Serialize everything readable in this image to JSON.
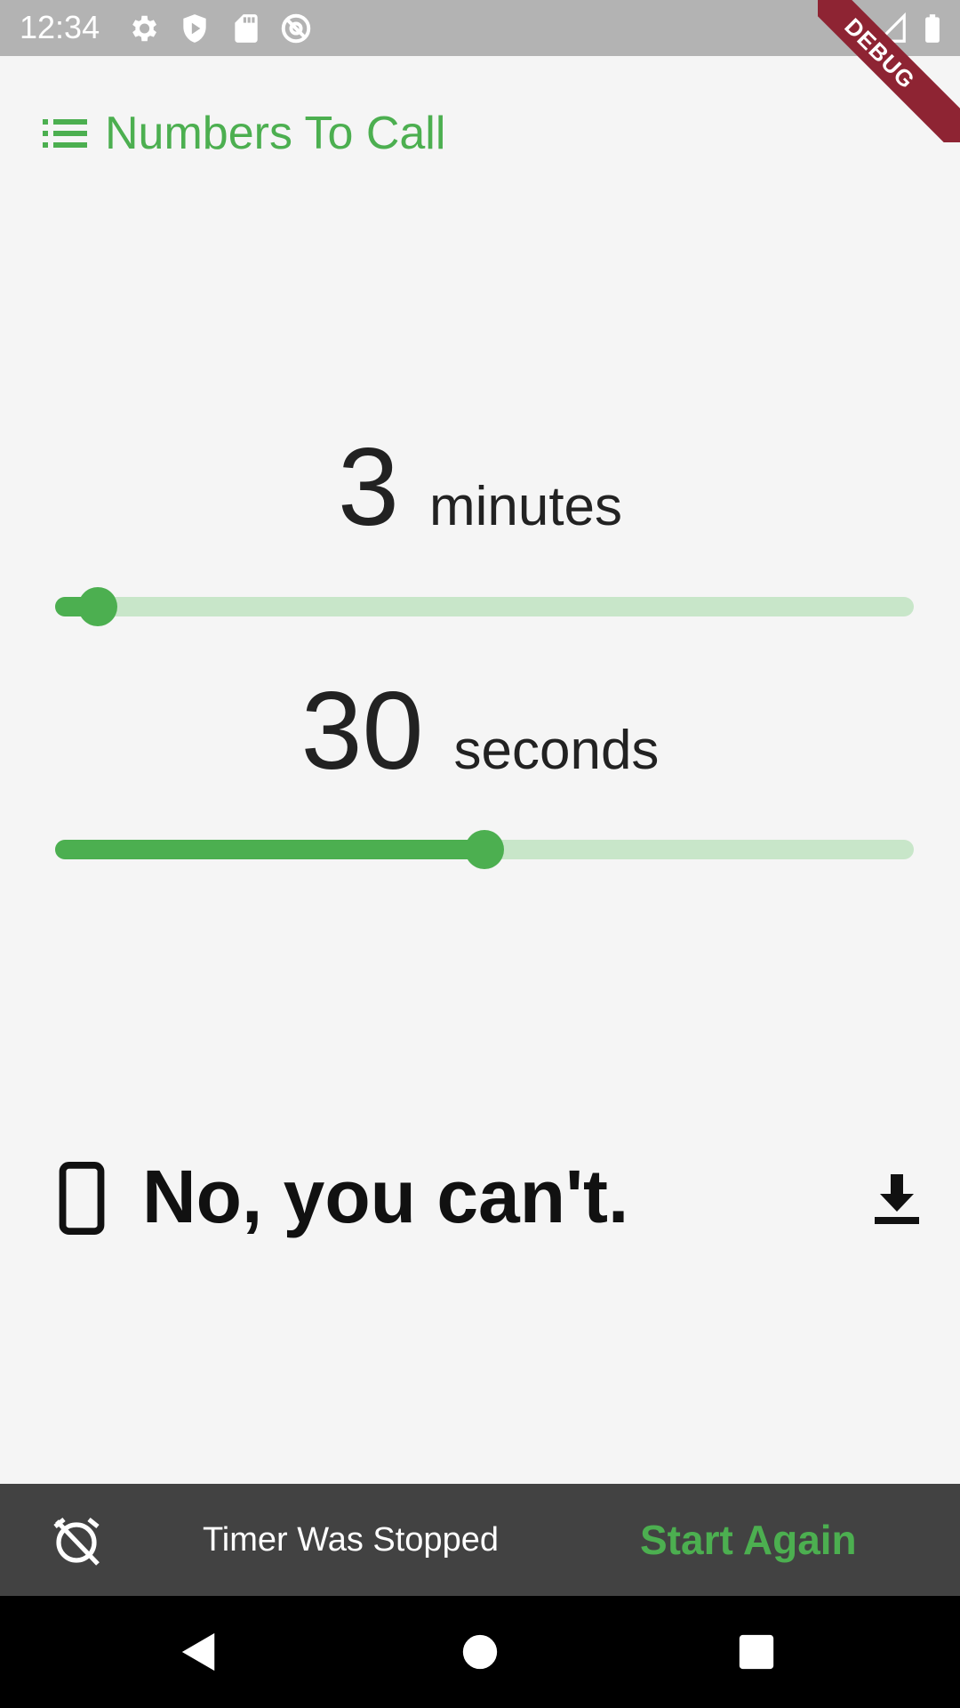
{
  "status_bar": {
    "time": "12:34",
    "icons": [
      "settings-icon",
      "shield-play-icon",
      "sd-card-icon",
      "at-sign-icon",
      "wifi-icon",
      "signal-icon",
      "battery-icon"
    ],
    "debug_banner": "DEBUG"
  },
  "header": {
    "icon": "list-icon",
    "title": "Numbers To Call"
  },
  "minutes": {
    "value": "3",
    "unit": "minutes",
    "slider_fraction": 0.05
  },
  "seconds": {
    "value": "30",
    "unit": "seconds",
    "slider_fraction": 0.5
  },
  "message": {
    "leading_icon": "smartphone-icon",
    "text": "No, you can't.",
    "trailing_icon": "download-icon"
  },
  "snackbar": {
    "icon": "alarm-off-icon",
    "text": "Timer Was Stopped",
    "action": "Start Again"
  },
  "nav_bar": {
    "buttons": [
      "back-icon",
      "home-icon",
      "recents-icon"
    ]
  },
  "colors": {
    "accent": "#4caf50",
    "accent_light": "#c8e6c9",
    "snackbar_bg": "#424242",
    "status_bar_bg": "#b3b3b3",
    "background": "#f5f5f5"
  }
}
